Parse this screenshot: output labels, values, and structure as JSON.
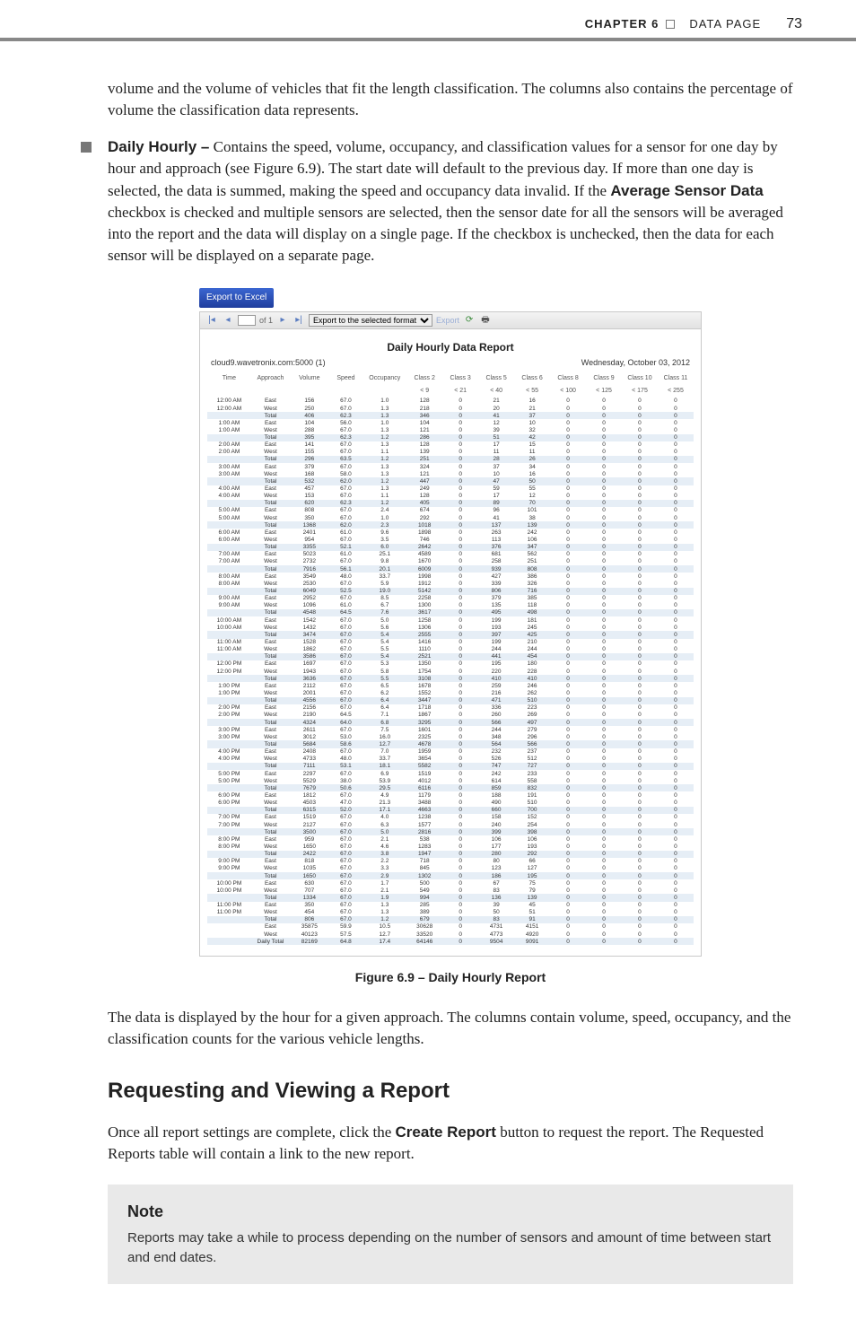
{
  "header": {
    "chapter_label": "CHAPTER 6",
    "chapter_title": "DATA PAGE",
    "page_number": "73"
  },
  "para_intro": "volume and the volume of vehicles that fit the length classification. The columns also contains the percentage of volume the classification data represents.",
  "bullet_title": "Daily Hourly –",
  "bullet_body": " Contains the speed, volume, occupancy, and classification values for a sensor for one day by hour and approach (see Figure 6.9). The start date will default to the previous day.  If more than one day is selected, the data is summed, making the speed and occupancy data invalid. If the ",
  "bullet_bold_inline": "Average Sensor Data",
  "bullet_body2": " checkbox is checked and multiple sensors are selected, then the sensor date for all the sensors will be averaged into the report and the data will display on a single page. If the checkbox is unchecked, then the data for each sensor will be displayed on a separate page.",
  "figure": {
    "export_label": "Export to Excel",
    "toolbar": {
      "page_of": "of 1",
      "format_label": "Export to the selected format",
      "export_link": "Export"
    },
    "report_title": "Daily Hourly Data Report",
    "meta_left": "cloud9.wavetronix.com:5000 (1)",
    "meta_right": "Wednesday, October 03, 2012",
    "columns": [
      "Time",
      "Approach",
      "Volume",
      "Speed",
      "Occupancy",
      "Class 2",
      "Class 3",
      "Class 5",
      "Class 6",
      "Class 8",
      "Class 9",
      "Class 10",
      "Class 11"
    ],
    "thresholds": [
      "",
      "",
      "",
      "",
      "",
      "< 9",
      "< 21",
      "< 40",
      "< 55",
      "< 100",
      "< 125",
      "< 175",
      "< 255"
    ],
    "rows": [
      [
        "12:00 AM",
        "East",
        "156",
        "67.0",
        "1.0",
        "128",
        "0",
        "21",
        "16",
        "0",
        "0",
        "0",
        "0"
      ],
      [
        "12:00 AM",
        "West",
        "250",
        "67.0",
        "1.3",
        "218",
        "0",
        "20",
        "21",
        "0",
        "0",
        "0",
        "0"
      ],
      [
        "",
        "Total",
        "406",
        "62.3",
        "1.3",
        "346",
        "0",
        "41",
        "37",
        "0",
        "0",
        "0",
        "0"
      ],
      [
        "1:00 AM",
        "East",
        "104",
        "56.0",
        "1.0",
        "104",
        "0",
        "12",
        "10",
        "0",
        "0",
        "0",
        "0"
      ],
      [
        "1:00 AM",
        "West",
        "288",
        "67.0",
        "1.3",
        "121",
        "0",
        "39",
        "32",
        "0",
        "0",
        "0",
        "0"
      ],
      [
        "",
        "Total",
        "395",
        "62.3",
        "1.2",
        "286",
        "0",
        "51",
        "42",
        "0",
        "0",
        "0",
        "0"
      ],
      [
        "2:00 AM",
        "East",
        "141",
        "67.0",
        "1.3",
        "128",
        "0",
        "17",
        "15",
        "0",
        "0",
        "0",
        "0"
      ],
      [
        "2:00 AM",
        "West",
        "155",
        "67.0",
        "1.1",
        "139",
        "0",
        "11",
        "11",
        "0",
        "0",
        "0",
        "0"
      ],
      [
        "",
        "Total",
        "296",
        "63.5",
        "1.2",
        "251",
        "0",
        "28",
        "26",
        "0",
        "0",
        "0",
        "0"
      ],
      [
        "3:00 AM",
        "East",
        "379",
        "67.0",
        "1.3",
        "324",
        "0",
        "37",
        "34",
        "0",
        "0",
        "0",
        "0"
      ],
      [
        "3:00 AM",
        "West",
        "168",
        "58.0",
        "1.3",
        "121",
        "0",
        "10",
        "16",
        "0",
        "0",
        "0",
        "0"
      ],
      [
        "",
        "Total",
        "532",
        "62.0",
        "1.2",
        "447",
        "0",
        "47",
        "50",
        "0",
        "0",
        "0",
        "0"
      ],
      [
        "4:00 AM",
        "East",
        "457",
        "67.0",
        "1.3",
        "249",
        "0",
        "59",
        "55",
        "0",
        "0",
        "0",
        "0"
      ],
      [
        "4:00 AM",
        "West",
        "153",
        "67.0",
        "1.1",
        "128",
        "0",
        "17",
        "12",
        "0",
        "0",
        "0",
        "0"
      ],
      [
        "",
        "Total",
        "620",
        "62.3",
        "1.2",
        "405",
        "0",
        "89",
        "70",
        "0",
        "0",
        "0",
        "0"
      ],
      [
        "5:00 AM",
        "East",
        "808",
        "67.0",
        "2.4",
        "674",
        "0",
        "96",
        "101",
        "0",
        "0",
        "0",
        "0"
      ],
      [
        "5:00 AM",
        "West",
        "350",
        "67.0",
        "1.0",
        "292",
        "0",
        "41",
        "38",
        "0",
        "0",
        "0",
        "0"
      ],
      [
        "",
        "Total",
        "1368",
        "62.0",
        "2.3",
        "1018",
        "0",
        "137",
        "139",
        "0",
        "0",
        "0",
        "0"
      ],
      [
        "6:00 AM",
        "East",
        "2401",
        "61.0",
        "9.6",
        "1898",
        "0",
        "263",
        "242",
        "0",
        "0",
        "0",
        "0"
      ],
      [
        "6:00 AM",
        "West",
        "954",
        "67.0",
        "3.5",
        "746",
        "0",
        "113",
        "106",
        "0",
        "0",
        "0",
        "0"
      ],
      [
        "",
        "Total",
        "3355",
        "52.1",
        "6.0",
        "2642",
        "0",
        "376",
        "347",
        "0",
        "0",
        "0",
        "0"
      ],
      [
        "7:00 AM",
        "East",
        "5023",
        "61.0",
        "25.1",
        "4589",
        "0",
        "681",
        "562",
        "0",
        "0",
        "0",
        "0"
      ],
      [
        "7:00 AM",
        "West",
        "2732",
        "67.0",
        "9.8",
        "1670",
        "0",
        "258",
        "251",
        "0",
        "0",
        "0",
        "0"
      ],
      [
        "",
        "Total",
        "7916",
        "56.1",
        "20.1",
        "6009",
        "0",
        "939",
        "808",
        "0",
        "0",
        "0",
        "0"
      ],
      [
        "8:00 AM",
        "East",
        "3549",
        "48.0",
        "33.7",
        "1998",
        "0",
        "427",
        "386",
        "0",
        "0",
        "0",
        "0"
      ],
      [
        "8:00 AM",
        "West",
        "2530",
        "67.0",
        "5.9",
        "1912",
        "0",
        "339",
        "326",
        "0",
        "0",
        "0",
        "0"
      ],
      [
        "",
        "Total",
        "6049",
        "52.5",
        "19.0",
        "5142",
        "0",
        "806",
        "716",
        "0",
        "0",
        "0",
        "0"
      ],
      [
        "9:00 AM",
        "East",
        "2952",
        "67.0",
        "8.5",
        "2258",
        "0",
        "379",
        "385",
        "0",
        "0",
        "0",
        "0"
      ],
      [
        "9:00 AM",
        "West",
        "1096",
        "61.0",
        "6.7",
        "1300",
        "0",
        "135",
        "118",
        "0",
        "0",
        "0",
        "0"
      ],
      [
        "",
        "Total",
        "4548",
        "64.5",
        "7.6",
        "3617",
        "0",
        "495",
        "498",
        "0",
        "0",
        "0",
        "0"
      ],
      [
        "10:00 AM",
        "East",
        "1542",
        "67.0",
        "5.0",
        "1258",
        "0",
        "199",
        "181",
        "0",
        "0",
        "0",
        "0"
      ],
      [
        "10:00 AM",
        "West",
        "1432",
        "67.0",
        "5.6",
        "1306",
        "0",
        "193",
        "245",
        "0",
        "0",
        "0",
        "0"
      ],
      [
        "",
        "Total",
        "3474",
        "67.0",
        "5.4",
        "2555",
        "0",
        "397",
        "425",
        "0",
        "0",
        "0",
        "0"
      ],
      [
        "11:00 AM",
        "East",
        "1528",
        "67.0",
        "5.4",
        "1416",
        "0",
        "199",
        "210",
        "0",
        "0",
        "0",
        "0"
      ],
      [
        "11:00 AM",
        "West",
        "1862",
        "67.0",
        "5.5",
        "1110",
        "0",
        "244",
        "244",
        "0",
        "0",
        "0",
        "0"
      ],
      [
        "",
        "Total",
        "3586",
        "67.0",
        "5.4",
        "2521",
        "0",
        "441",
        "454",
        "0",
        "0",
        "0",
        "0"
      ],
      [
        "12:00 PM",
        "East",
        "1697",
        "67.0",
        "5.3",
        "1350",
        "0",
        "195",
        "180",
        "0",
        "0",
        "0",
        "0"
      ],
      [
        "12:00 PM",
        "West",
        "1943",
        "67.0",
        "5.8",
        "1754",
        "0",
        "220",
        "228",
        "0",
        "0",
        "0",
        "0"
      ],
      [
        "",
        "Total",
        "3636",
        "67.0",
        "5.5",
        "3108",
        "0",
        "410",
        "410",
        "0",
        "0",
        "0",
        "0"
      ],
      [
        "1:00 PM",
        "East",
        "2112",
        "67.0",
        "6.5",
        "1678",
        "0",
        "259",
        "246",
        "0",
        "0",
        "0",
        "0"
      ],
      [
        "1:00 PM",
        "West",
        "2001",
        "67.0",
        "6.2",
        "1552",
        "0",
        "216",
        "262",
        "0",
        "0",
        "0",
        "0"
      ],
      [
        "",
        "Total",
        "4556",
        "67.0",
        "6.4",
        "3447",
        "0",
        "471",
        "510",
        "0",
        "0",
        "0",
        "0"
      ],
      [
        "2:00 PM",
        "East",
        "2156",
        "67.0",
        "6.4",
        "1718",
        "0",
        "336",
        "223",
        "0",
        "0",
        "0",
        "0"
      ],
      [
        "2:00 PM",
        "West",
        "2190",
        "64.5",
        "7.1",
        "1867",
        "0",
        "260",
        "269",
        "0",
        "0",
        "0",
        "0"
      ],
      [
        "",
        "Total",
        "4324",
        "64.0",
        "6.8",
        "3295",
        "0",
        "566",
        "497",
        "0",
        "0",
        "0",
        "0"
      ],
      [
        "3:00 PM",
        "East",
        "2611",
        "67.0",
        "7.5",
        "1601",
        "0",
        "244",
        "279",
        "0",
        "0",
        "0",
        "0"
      ],
      [
        "3:00 PM",
        "West",
        "3012",
        "53.0",
        "16.0",
        "2325",
        "0",
        "348",
        "296",
        "0",
        "0",
        "0",
        "0"
      ],
      [
        "",
        "Total",
        "5684",
        "58.6",
        "12.7",
        "4678",
        "0",
        "564",
        "566",
        "0",
        "0",
        "0",
        "0"
      ],
      [
        "4:00 PM",
        "East",
        "2408",
        "67.0",
        "7.0",
        "1959",
        "0",
        "232",
        "237",
        "0",
        "0",
        "0",
        "0"
      ],
      [
        "4:00 PM",
        "West",
        "4733",
        "48.0",
        "33.7",
        "3654",
        "0",
        "526",
        "512",
        "0",
        "0",
        "0",
        "0"
      ],
      [
        "",
        "Total",
        "7111",
        "53.1",
        "18.1",
        "5582",
        "0",
        "747",
        "727",
        "0",
        "0",
        "0",
        "0"
      ],
      [
        "5:00 PM",
        "East",
        "2297",
        "67.0",
        "6.9",
        "1519",
        "0",
        "242",
        "233",
        "0",
        "0",
        "0",
        "0"
      ],
      [
        "5:00 PM",
        "West",
        "5529",
        "38.0",
        "53.9",
        "4012",
        "0",
        "614",
        "558",
        "0",
        "0",
        "0",
        "0"
      ],
      [
        "",
        "Total",
        "7679",
        "50.6",
        "29.5",
        "6116",
        "0",
        "859",
        "832",
        "0",
        "0",
        "0",
        "0"
      ],
      [
        "6:00 PM",
        "East",
        "1812",
        "67.0",
        "4.9",
        "1179",
        "0",
        "188",
        "191",
        "0",
        "0",
        "0",
        "0"
      ],
      [
        "6:00 PM",
        "West",
        "4503",
        "47.0",
        "21.3",
        "3488",
        "0",
        "490",
        "510",
        "0",
        "0",
        "0",
        "0"
      ],
      [
        "",
        "Total",
        "6315",
        "52.0",
        "17.1",
        "4663",
        "0",
        "660",
        "700",
        "0",
        "0",
        "0",
        "0"
      ],
      [
        "7:00 PM",
        "East",
        "1519",
        "67.0",
        "4.0",
        "1238",
        "0",
        "158",
        "152",
        "0",
        "0",
        "0",
        "0"
      ],
      [
        "7:00 PM",
        "West",
        "2127",
        "67.0",
        "6.3",
        "1577",
        "0",
        "240",
        "254",
        "0",
        "0",
        "0",
        "0"
      ],
      [
        "",
        "Total",
        "3500",
        "67.0",
        "5.0",
        "2816",
        "0",
        "399",
        "398",
        "0",
        "0",
        "0",
        "0"
      ],
      [
        "8:00 PM",
        "East",
        "959",
        "67.0",
        "2.1",
        "538",
        "0",
        "106",
        "106",
        "0",
        "0",
        "0",
        "0"
      ],
      [
        "8:00 PM",
        "West",
        "1650",
        "67.0",
        "4.6",
        "1283",
        "0",
        "177",
        "193",
        "0",
        "0",
        "0",
        "0"
      ],
      [
        "",
        "Total",
        "2422",
        "67.0",
        "3.8",
        "1947",
        "0",
        "280",
        "292",
        "0",
        "0",
        "0",
        "0"
      ],
      [
        "9:00 PM",
        "East",
        "818",
        "67.0",
        "2.2",
        "718",
        "0",
        "80",
        "66",
        "0",
        "0",
        "0",
        "0"
      ],
      [
        "9:00 PM",
        "West",
        "1035",
        "67.0",
        "3.3",
        "845",
        "0",
        "123",
        "127",
        "0",
        "0",
        "0",
        "0"
      ],
      [
        "",
        "Total",
        "1650",
        "67.0",
        "2.9",
        "1302",
        "0",
        "186",
        "195",
        "0",
        "0",
        "0",
        "0"
      ],
      [
        "10:00 PM",
        "East",
        "630",
        "67.0",
        "1.7",
        "500",
        "0",
        "67",
        "75",
        "0",
        "0",
        "0",
        "0"
      ],
      [
        "10:00 PM",
        "West",
        "707",
        "67.0",
        "2.1",
        "549",
        "0",
        "83",
        "79",
        "0",
        "0",
        "0",
        "0"
      ],
      [
        "",
        "Total",
        "1334",
        "67.0",
        "1.9",
        "994",
        "0",
        "136",
        "139",
        "0",
        "0",
        "0",
        "0"
      ],
      [
        "11:00 PM",
        "East",
        "350",
        "67.0",
        "1.3",
        "285",
        "0",
        "39",
        "45",
        "0",
        "0",
        "0",
        "0"
      ],
      [
        "11:00 PM",
        "West",
        "454",
        "67.0",
        "1.3",
        "389",
        "0",
        "50",
        "51",
        "0",
        "0",
        "0",
        "0"
      ],
      [
        "",
        "Total",
        "806",
        "67.0",
        "1.2",
        "679",
        "0",
        "83",
        "91",
        "0",
        "0",
        "0",
        "0"
      ],
      [
        "",
        "East",
        "35875",
        "59.9",
        "10.5",
        "30628",
        "0",
        "4731",
        "4151",
        "0",
        "0",
        "0",
        "0"
      ],
      [
        "",
        "West",
        "40123",
        "57.5",
        "12.7",
        "33520",
        "0",
        "4773",
        "4920",
        "0",
        "0",
        "0",
        "0"
      ],
      [
        "",
        "Daily Total",
        "82169",
        "64.8",
        "17.4",
        "64146",
        "0",
        "9504",
        "9091",
        "0",
        "0",
        "0",
        "0"
      ]
    ]
  },
  "caption": "Figure 6.9 – Daily Hourly Report",
  "para_after_fig": "The data is displayed by the hour for a given approach. The columns contain volume, speed, occupancy, and the classification counts for the various vehicle lengths.",
  "section_heading": "Requesting and Viewing a Report",
  "para_section_a": "Once all report settings are complete, click the ",
  "para_section_bold": "Create Report",
  "para_section_b": " button to request the report. The Requested Reports table will contain a link to the new report.",
  "note": {
    "title": "Note",
    "body": "Reports may take a while to process depending on the number of sensors and amount of time between start and end dates."
  }
}
